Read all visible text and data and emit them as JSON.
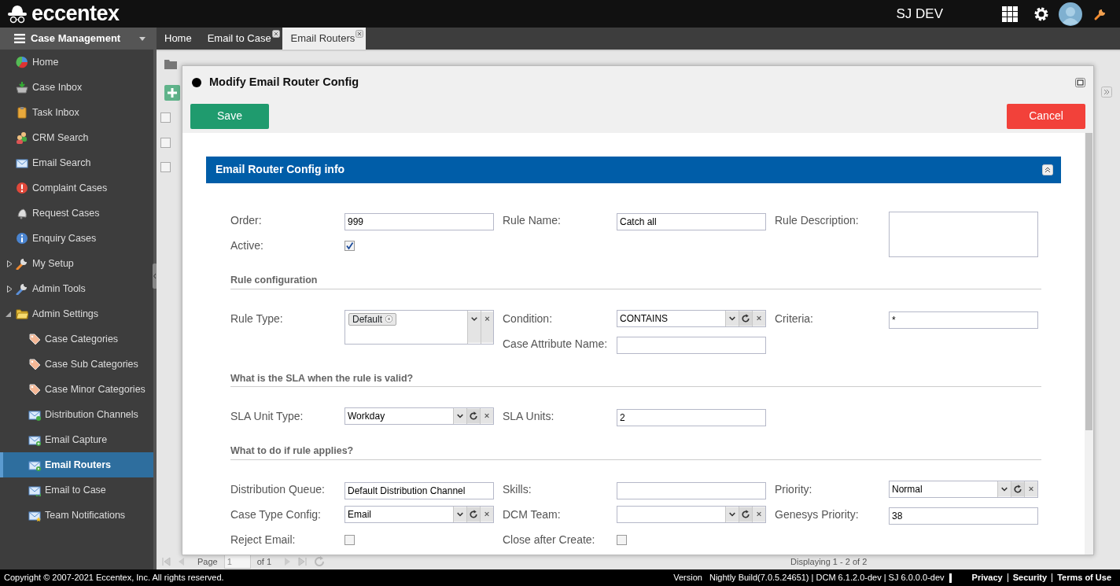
{
  "header": {
    "logo": "eccentex",
    "user": "SJ DEV"
  },
  "sidebar": {
    "title": "Case Management",
    "items": [
      {
        "label": "Home",
        "selected": false
      },
      {
        "label": "Case Inbox",
        "selected": false
      },
      {
        "label": "Task Inbox",
        "selected": false
      },
      {
        "label": "CRM Search",
        "selected": false
      },
      {
        "label": "Email Search",
        "selected": false
      },
      {
        "label": "Complaint Cases",
        "selected": false
      },
      {
        "label": "Request Cases",
        "selected": false
      },
      {
        "label": "Enquiry Cases",
        "selected": false
      },
      {
        "label": "My Setup",
        "selected": false,
        "expanded": false
      },
      {
        "label": "Admin Tools",
        "selected": false,
        "expanded": false
      },
      {
        "label": "Admin Settings",
        "selected": false,
        "expanded": true,
        "children": [
          {
            "label": "Case Categories",
            "selected": false
          },
          {
            "label": "Case Sub Categories",
            "selected": false
          },
          {
            "label": "Case Minor Categories",
            "selected": false
          },
          {
            "label": "Distribution Channels",
            "selected": false
          },
          {
            "label": "Email Capture",
            "selected": false
          },
          {
            "label": "Email Routers",
            "selected": true
          },
          {
            "label": "Email to Case",
            "selected": false
          },
          {
            "label": "Team Notifications",
            "selected": false
          }
        ]
      }
    ]
  },
  "tabs": [
    {
      "label": "Home",
      "selected": false,
      "closable": false
    },
    {
      "label": "Email to Case",
      "selected": false,
      "closable": true
    },
    {
      "label": "Email Routers",
      "selected": true,
      "closable": true
    }
  ],
  "background": {
    "select_all": {
      "checked": false
    },
    "rows": [
      {
        "checked": false
      },
      {
        "checked": false
      }
    ],
    "pager": {
      "page_label": "Page",
      "page": "1",
      "of": "of 1",
      "displaying": "Displaying 1 - 2 of 2"
    }
  },
  "modal": {
    "title": "Modify Email Router Config",
    "save": "Save",
    "cancel": "Cancel",
    "section_title": "Email Router Config info",
    "groups": [
      {
        "fields": [
          {
            "label": "Order:",
            "kind": "text",
            "value": "999"
          },
          {
            "label": "Rule Name:",
            "kind": "text",
            "value": "Catch all"
          },
          {
            "label": "Rule Description:",
            "kind": "textarea"
          },
          {
            "label": "Active:",
            "kind": "checkbox",
            "checked": true
          }
        ]
      },
      {
        "heading": "Rule configuration",
        "fields": [
          {
            "label": "Rule Type:",
            "kind": "tags",
            "tags": [
              "Default"
            ]
          },
          {
            "label": "Condition:",
            "kind": "combo",
            "value": "CONTAINS",
            "refresh": true
          },
          {
            "label": "Criteria:",
            "kind": "text",
            "value": "*"
          },
          {
            "label": "Case Attribute Name:",
            "kind": "text"
          }
        ]
      },
      {
        "heading": "What is the SLA when the rule is valid?",
        "fields": [
          {
            "label": "SLA Unit Type:",
            "kind": "combo",
            "value": "Workday",
            "refresh": true
          },
          {
            "label": "SLA Units:",
            "kind": "text",
            "value": "2"
          }
        ]
      },
      {
        "heading": "What to do if rule applies?",
        "fields": [
          {
            "label": "Distribution Queue:",
            "kind": "text",
            "value": "Default Distribution Channel"
          },
          {
            "label": "Skills:",
            "kind": "text"
          },
          {
            "label": "Priority:",
            "kind": "combo",
            "value": "Normal",
            "refresh": true
          },
          {
            "label": "Case Type Config:",
            "kind": "combo",
            "value": "Email",
            "refresh": true
          },
          {
            "label": "DCM Team:",
            "kind": "combo",
            "refresh": true
          },
          {
            "label": "Genesys Priority:",
            "kind": "text",
            "value": "38"
          },
          {
            "label": "Reject Email:",
            "kind": "checkbox",
            "checked": false
          },
          {
            "label": "Close after Create:",
            "kind": "checkbox",
            "checked": false
          }
        ]
      }
    ]
  },
  "footer": {
    "copyright": "Copyright © 2007-2021 Eccentex, Inc. All rights reserved.",
    "version_label": "Version",
    "version": "Nightly Build(7.0.5.24651) | DCM 6.1.2.0-dev | SJ 6.0.0.0-dev",
    "links": [
      "Privacy",
      "Security",
      "Terms of Use"
    ]
  }
}
